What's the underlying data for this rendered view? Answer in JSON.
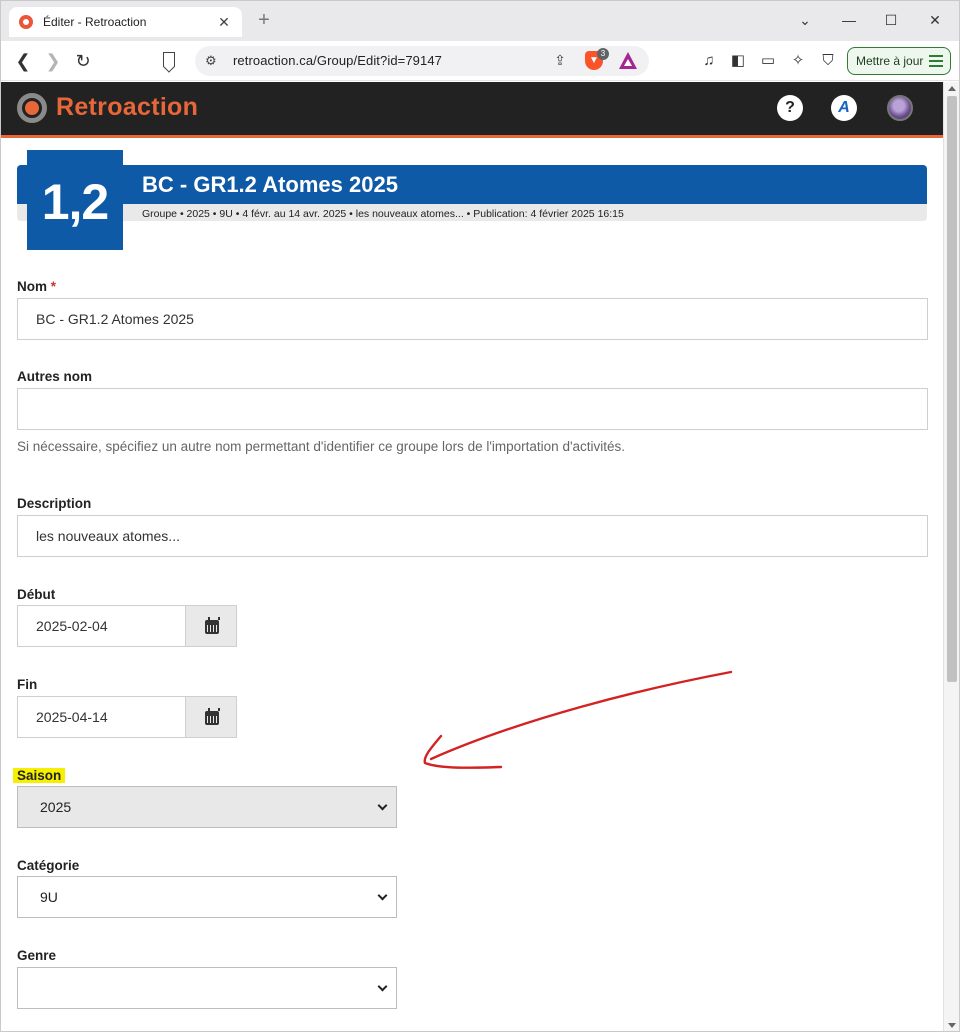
{
  "browser": {
    "tab_title": "Éditer - Retroaction",
    "url": "retroaction.ca/Group/Edit?id=79147",
    "shields_count": "3",
    "update_label": "Mettre à jour"
  },
  "app": {
    "logo_text": "Retroaction",
    "help_glyph": "?",
    "academy_glyph": "A"
  },
  "group": {
    "badge": "1,2",
    "title": "BC - GR1.2 Atomes 2025",
    "subtitle": "Groupe • 2025 • 9U • 4 févr. au 14 avr. 2025 • les nouveaux atomes... • Publication: 4 février 2025 16:15"
  },
  "form": {
    "nom": {
      "label": "Nom",
      "required_mark": "*",
      "value": "BC - GR1.2 Atomes 2025"
    },
    "autres_nom": {
      "label": "Autres nom",
      "value": "",
      "help": "Si nécessaire, spécifiez un autre nom permettant d'identifier ce groupe lors de l'importation d'activités."
    },
    "description": {
      "label": "Description",
      "value": "les nouveaux atomes..."
    },
    "debut": {
      "label": "Début",
      "value": "2025-02-04"
    },
    "fin": {
      "label": "Fin",
      "value": "2025-04-14"
    },
    "saison": {
      "label": "Saison",
      "value": "2025"
    },
    "categorie": {
      "label": "Catégorie",
      "value": "9U"
    },
    "genre": {
      "label": "Genre",
      "value": ""
    }
  },
  "colors": {
    "brand_orange": "#e8673a",
    "banner_blue": "#0f5aa6",
    "annotation_red": "#d32222",
    "highlight_yellow": "#f6f000"
  }
}
